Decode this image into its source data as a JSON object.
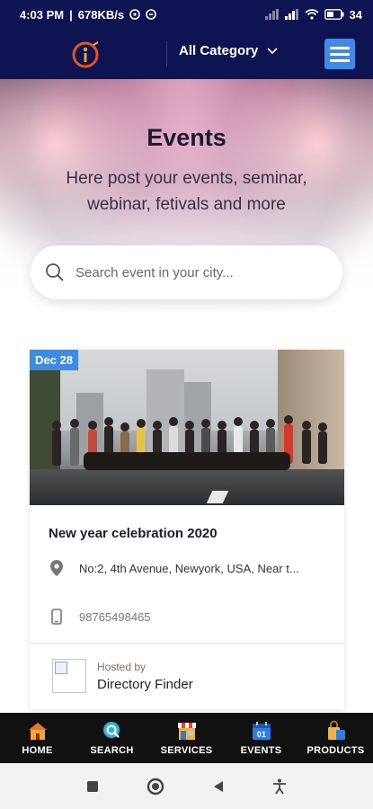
{
  "status_bar": {
    "time": "4:03 PM",
    "network_speed": "678KB/s",
    "battery": "34"
  },
  "header": {
    "category_label": "All Category"
  },
  "hero": {
    "title": "Events",
    "subtitle": "Here post your events, seminar, webinar, fetivals and more"
  },
  "search": {
    "placeholder": "Search event in your city..."
  },
  "event_card": {
    "date": "Dec 28",
    "title": "New year celebration 2020",
    "address": "No:2, 4th Avenue,  Newyork, USA, Near t...",
    "phone": "98765498465",
    "hosted_by_label": "Hosted by",
    "host_name": "Directory Finder"
  },
  "bottom_nav": {
    "items": [
      {
        "label": "HOME",
        "icon": "home-icon"
      },
      {
        "label": "SEARCH",
        "icon": "search-icon"
      },
      {
        "label": "SERVICES",
        "icon": "store-icon"
      },
      {
        "label": "EVENTS",
        "icon": "calendar-icon"
      },
      {
        "label": "PRODUCTS",
        "icon": "shopping-bag-icon"
      }
    ]
  },
  "colors": {
    "header_bg": "#0e1452",
    "accent": "#3c8ce7",
    "nav_bg": "#111111"
  }
}
